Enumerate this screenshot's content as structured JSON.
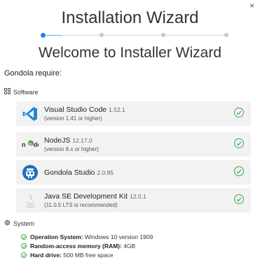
{
  "window": {
    "close_glyph": "×"
  },
  "header": {
    "title": "Installation Wizard",
    "steps_total": 4,
    "current_step": 1
  },
  "welcome": "Welcome to Installer Wizard",
  "require_label": "Gondola require:",
  "software": {
    "label": "Software",
    "icon": "grid-icon",
    "items": [
      {
        "name": "Visual Studio Code",
        "version": "1.52.1",
        "note": "(version 1.41 or higher)",
        "icon": "vscode-icon",
        "status": "ok"
      },
      {
        "name": "NodeJS",
        "version": "12.17.0",
        "note": "(version 8.x or higher)",
        "icon": "nodejs-icon",
        "status": "ok"
      },
      {
        "name": "Gondola Studio",
        "version": "2.0.85",
        "note": "",
        "icon": "gondola-icon",
        "status": "ok"
      },
      {
        "name": "Java SE Development Kit",
        "version": "12.0.1",
        "note": "(11.0.5 LTS is recommended)",
        "icon": "java-icon",
        "status": "ok"
      }
    ]
  },
  "system": {
    "label": "System",
    "icon": "gear-icon",
    "items": [
      {
        "label": "Operation System:",
        "value": "Windows 10 version 1909"
      },
      {
        "label": "Random-access memory (RAM):",
        "value": "4GB"
      },
      {
        "label": "Hard drive:",
        "value": "500 MB free space"
      }
    ]
  },
  "colors": {
    "accent": "#1e88e5",
    "ok": "#3cab4d",
    "card_bg": "#f2f2f2"
  }
}
